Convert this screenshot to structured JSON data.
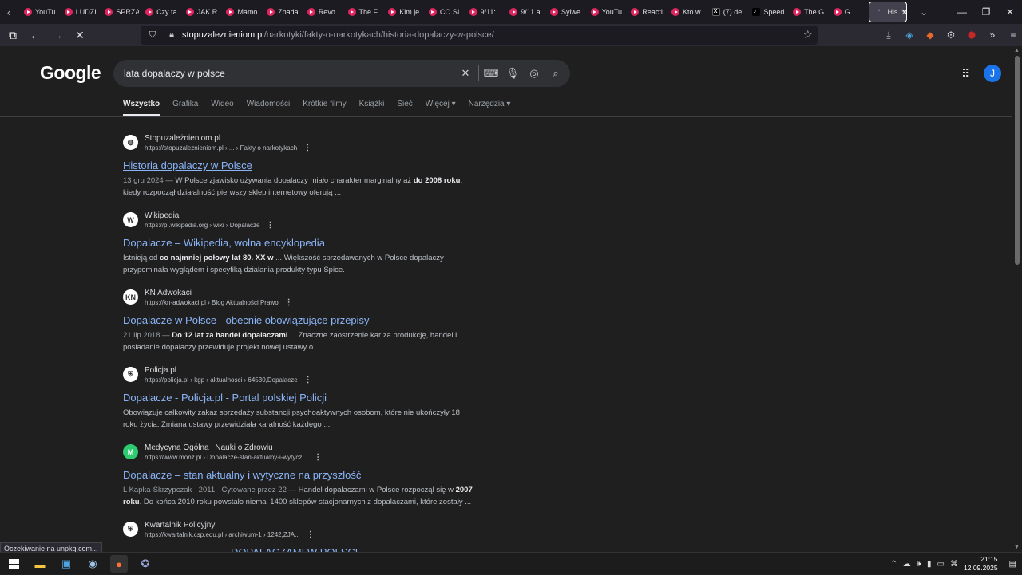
{
  "tabs": [
    {
      "label": "YouTu",
      "icon": "youtube-icon"
    },
    {
      "label": "LUDZI",
      "icon": "youtube-icon"
    },
    {
      "label": "SPRZA",
      "icon": "youtube-icon"
    },
    {
      "label": "Czy ta",
      "icon": "youtube-icon"
    },
    {
      "label": "JAK R",
      "icon": "youtube-icon"
    },
    {
      "label": "Mamo",
      "icon": "youtube-icon"
    },
    {
      "label": "Zbada",
      "icon": "youtube-icon"
    },
    {
      "label": "Revo",
      "icon": "youtube-icon"
    },
    {
      "label": "The F",
      "icon": "youtube-icon"
    },
    {
      "label": "Kim je",
      "icon": "youtube-icon"
    },
    {
      "label": "CO SI",
      "icon": "youtube-icon"
    },
    {
      "label": "9/11: ",
      "icon": "youtube-icon"
    },
    {
      "label": "9/11 a",
      "icon": "youtube-icon"
    },
    {
      "label": "Sylwe",
      "icon": "youtube-icon"
    },
    {
      "label": "YouTu",
      "icon": "youtube-icon"
    },
    {
      "label": "Reacti",
      "icon": "youtube-icon"
    },
    {
      "label": "Kto w",
      "icon": "youtube-icon"
    },
    {
      "label": "(7) de",
      "icon": "x-icon"
    },
    {
      "label": "Speed",
      "icon": "tiktok-icon"
    },
    {
      "label": "The G",
      "icon": "youtube-icon"
    },
    {
      "label": "G",
      "icon": "youtube-icon"
    }
  ],
  "active_tab": {
    "label": "His",
    "close": "✕"
  },
  "url": {
    "domain": "stopuzaleznieniom.pl",
    "path": "/narkotyki/fakty-o-narkotykach/historia-dopalaczy-w-polsce/"
  },
  "google": {
    "logo": "Google",
    "query": "lata dopalaczy w polsce",
    "avatar_letter": "J",
    "tabs": [
      "Wszystko",
      "Grafika",
      "Wideo",
      "Wiadomości",
      "Krótkie filmy",
      "Książki",
      "Sieć",
      "Więcej ▾",
      "Narzędzia ▾"
    ]
  },
  "results": [
    {
      "site": "Stopuzależnieniom.pl",
      "url": "https://stopuzaleznieniom.pl › ... › Fakty o narkotykach",
      "icon_glyph": "◍",
      "title": "Historia dopalaczy w Polsce",
      "date": "13 gru 2024 —",
      "snippet_a": " W Polsce zjawisko używania dopalaczy miało charakter marginalny aż ",
      "snippet_b": "do 2008 roku",
      "snippet_c": ", kiedy rozpoczął działalność pierwszy sklep internetowy oferują ..."
    },
    {
      "site": "Wikipedia",
      "url": "https://pl.wikipedia.org › wiki › Dopalacze",
      "icon_glyph": "W",
      "title": "Dopalacze – Wikipedia, wolna encyklopedia",
      "date": "",
      "snippet_a": "Istnieją od ",
      "snippet_b": "co najmniej połowy lat 80. XX w",
      "snippet_c": " ... Większość sprzedawanych w Polsce dopalaczy przypominała wyglądem i specyfiką działania produkty typu Spice."
    },
    {
      "site": "KN Adwokaci",
      "url": "https://kn-adwokaci.pl › Blog Aktualności Prawo",
      "icon_glyph": "KN",
      "title": "Dopalacze w Polsce - obecnie obowiązujące przepisy",
      "date": "21 lip 2018 —",
      "snippet_a": " ",
      "snippet_b": "Do 12 lat za handel dopalaczami",
      "snippet_c": " ... Znaczne zaostrzenie kar za produkcję, handel i posiadanie dopalaczy przewiduje projekt nowej ustawy o ..."
    },
    {
      "site": "Policja.pl",
      "url": "https://policja.pl › kgp › aktualnosci › 64530,Dopalacze",
      "icon_glyph": "⛨",
      "title": "Dopalacze - Policja.pl - Portal polskiej Policji",
      "date": "",
      "snippet_a": "Obowiązuje całkowity zakaz sprzedaży substancji psychoaktywnych osobom, które nie ukończyły 18 roku życia. Zmiana ustawy przewidziała karalność każdego ...",
      "snippet_b": "",
      "snippet_c": ""
    },
    {
      "site": "Medycyna Ogólna i Nauki o Zdrowiu",
      "url": "https://www.monz.pl › Dopalacze-stan-aktualny-i-wytycz...",
      "icon_glyph": "M",
      "title": "Dopalacze – stan aktualny i wytyczne na przyszłość",
      "date": "L Kapka-Skrzypczak · 2011 · Cytowane przez 22 —",
      "snippet_a": " Handel dopalaczami w Polsce rozpoczął się w ",
      "snippet_b": "2007 roku",
      "snippet_c": ". Do końca 2010 roku powstało niemal 1400 sklepów stacjonarnych z dopalaczami, które zostały ..."
    },
    {
      "site": "Kwartalnik Policyjny",
      "url": "https://kwartalnik.csp.edu.pl › archiwum-1 › 1242,ZJA...",
      "icon_glyph": "⛨",
      "title": "DOPALACZAMI W POLSCE",
      "date": "",
      "snippet_a": "",
      "snippet_b": "",
      "snippet_c": ""
    }
  ],
  "status_text": "Oczekiwanie na unpkg.com...",
  "clock": {
    "time": "21:15",
    "date": "12.09.2025"
  },
  "colors": {
    "link": "#8ab4f8",
    "background": "#1f1f1f",
    "avatar": "#1a73e8"
  }
}
